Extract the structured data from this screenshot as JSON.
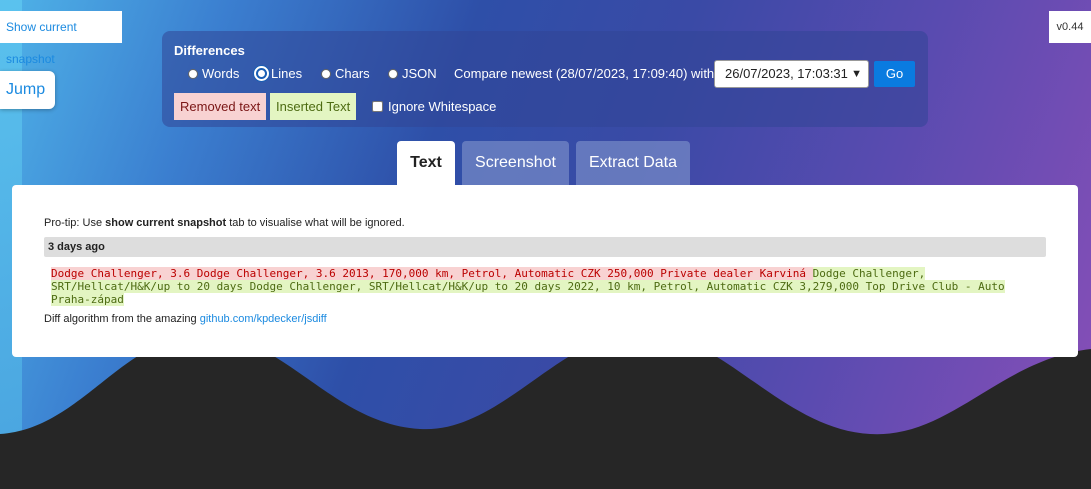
{
  "top": {
    "snapshot_button": "Show current snapshot",
    "version": "v0.44",
    "jump_button": "Jump"
  },
  "differences": {
    "title": "Differences",
    "modes": [
      "Words",
      "Lines",
      "Chars",
      "JSON"
    ],
    "selected_mode": "Lines",
    "compare_label": "Compare newest (28/07/2023, 17:09:40) with",
    "compare_select_value": "26/07/2023, 17:03:31",
    "go_button": "Go",
    "removed_legend": "Removed text",
    "inserted_legend": "Inserted Text",
    "ignore_whitespace": "Ignore Whitespace"
  },
  "tabs": [
    "Text",
    "Screenshot",
    "Extract Data"
  ],
  "content": {
    "protip_prefix": "Pro-tip: Use ",
    "protip_bold": "show current snapshot",
    "protip_suffix": " tab to visualise what will be ignored.",
    "age": "3 days ago",
    "removed_text": "  Dodge Challenger, 3.6 Dodge Challenger, 3.6 2013, 170,000 km, Petrol, Automatic CZK 250,000 Private dealer Karviná ",
    "inserted_text": " Dodge Challenger, SRT/Hellcat/H&K/up to 20 days Dodge Challenger, SRT/Hellcat/H&K/up to 20 days 2022, 10 km, Petrol, Automatic CZK 3,279,000 Top Drive Club - Auto Praha-západ",
    "credit_prefix": "Diff algorithm from the amazing ",
    "credit_link": "github.com/kpdecker/jsdiff"
  },
  "colors": {
    "removed_bg": "#f8d2d2",
    "inserted_bg": "#e3f5c2",
    "go_button": "#0a7be0"
  }
}
